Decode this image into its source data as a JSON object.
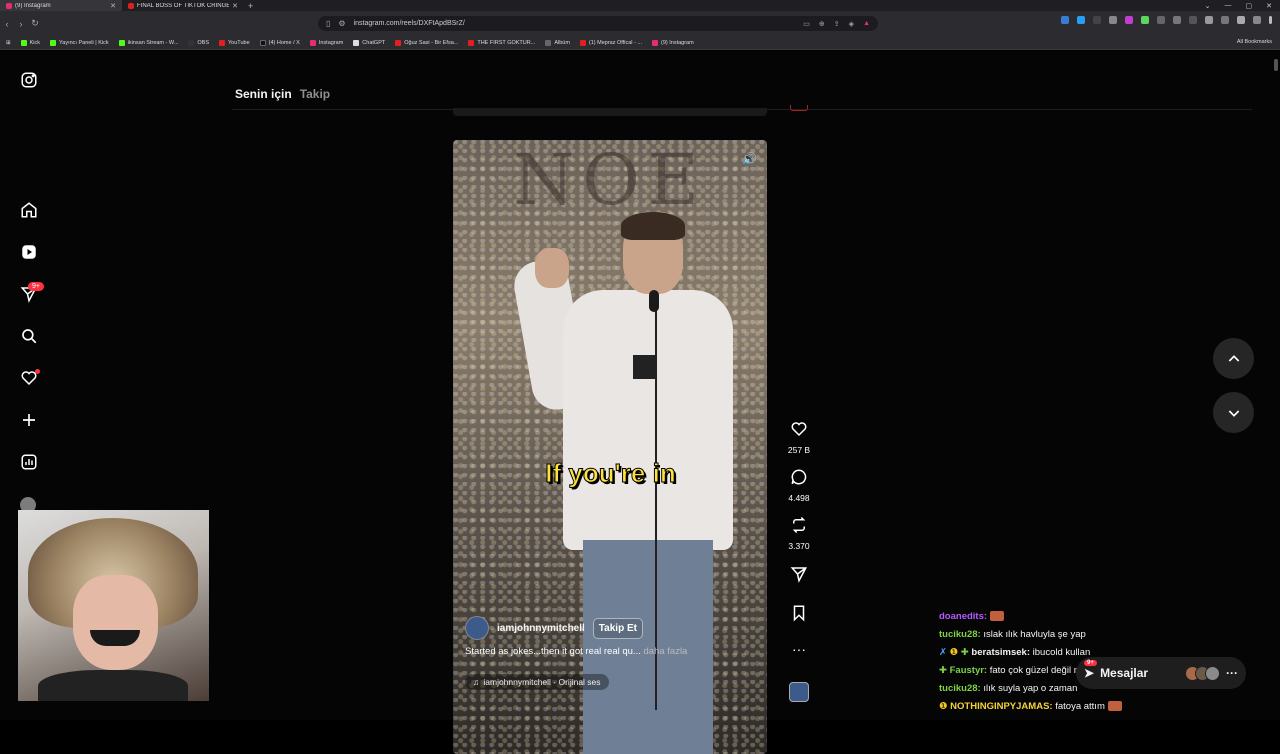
{
  "browser": {
    "tabs": [
      {
        "label": "(9) Instagram",
        "active": true
      },
      {
        "label": "FINAL BOSS OF TIKTOK CRINGE - You",
        "active": false
      }
    ],
    "url": "instagram.com/reels/DXFtApdBSrZ/",
    "bookmarks": [
      "Kick",
      "Yayıncı Paneli | Kick",
      "ikinsan Stream - W...",
      "OBS",
      "YouTube",
      "(4) Home / X",
      "Instagram",
      "ChatGPT",
      "Oğuz Sasi - Bir Efsa...",
      "THE FIRST GOKTUR...",
      "Albüm",
      "(1) Mepraz Offical - ...",
      "(9) Instagram"
    ],
    "all_bookmarks": "All Bookmarks"
  },
  "instagram": {
    "tabs": {
      "for_you": "Senin için",
      "following": "Takip"
    },
    "notification_badge": "9+",
    "reel": {
      "sign_text": "NOE",
      "caption_overlay": "If you're in",
      "username": "iamjohnnymitchell",
      "follow_label": "Takip Et",
      "caption": "Started as jokes...then it got real real qu...",
      "more": "daha fazla",
      "audio": "iamjohnnymitchell · Orijinal ses"
    },
    "actions": {
      "likes": "257 B",
      "comments": "4.498",
      "reposts": "3.370"
    },
    "messages": {
      "label": "Mesajlar",
      "badge": "9+"
    }
  },
  "chat": [
    {
      "user": "doanedits:",
      "text": "",
      "color": "#b45cff"
    },
    {
      "user": "tuciku28:",
      "text": "ıslak ılık havluyla şe yap",
      "color": "#7fd14a"
    },
    {
      "user": "beratsimsek:",
      "text": "ibucold kullan",
      "color": "#f2f2f2"
    },
    {
      "user": "Faustyr:",
      "text": "fato çok güzel değil mi",
      "color": "#7fd14a"
    },
    {
      "user": "tuciku28:",
      "text": "ılık suyla yap o zaman",
      "color": "#7fd14a"
    },
    {
      "user": "NOTHINGINPYJAMAS:",
      "text": "fatoya attım",
      "color": "#f5d43a"
    }
  ]
}
